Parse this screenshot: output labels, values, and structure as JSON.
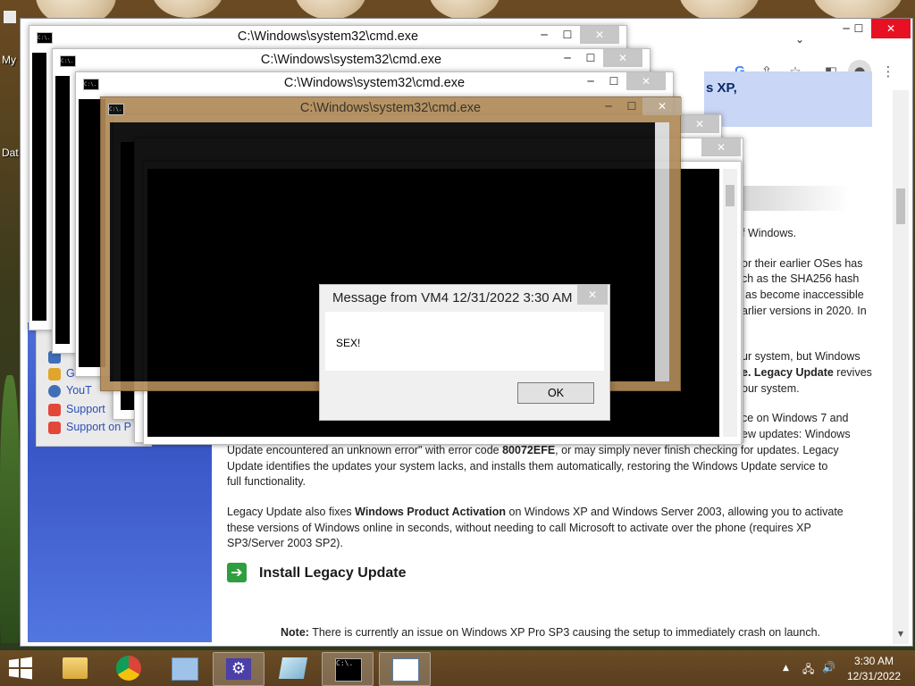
{
  "desktop": {
    "icon_label_1": "My",
    "icon_label_2": "Dat"
  },
  "browser": {
    "minimize": "─",
    "maximize": "☐",
    "close": "✕",
    "tab_dropdown": "⌄",
    "banner_text": "s XP,",
    "article": {
      "p1": "f Windows.",
      "p2a": "or their earlier OSes has",
      "p2b": "ch as the SHA256 hash",
      "p2c": "as become inaccessible",
      "p2d": "arlier versions in 2020. In",
      "p3a": "ur system, but Windows",
      "p3b_bold": "e. Legacy Update",
      "p3b_rest": " revives",
      "p3c": "our system.",
      "p4a": "ce on Windows 7 and",
      "p4b": "ew updates: Windows",
      "p4c_pre": "Update encountered an unknown error\" with error code ",
      "p4c_bold": "80072EFE",
      "p4c_post": ", or may simply never finish checking for updates. Legacy",
      "p4d": "Update identifies the updates your system lacks, and installs them automatically, restoring the Windows Update service to",
      "p4e": "full functionality.",
      "p5a_pre": "Legacy Update also fixes ",
      "p5a_bold": "Windows Product Activation",
      "p5a_post": " on Windows XP and Windows Server 2003, allowing you to activate",
      "p5b": "these versions of Windows online in seconds, without needing to call Microsoft to activate over the phone (requires XP",
      "p5c": "SP3/Server 2003 SP2).",
      "install_heading": "Install Legacy Update",
      "install_arrow": "➔",
      "note_bold": "Note:",
      "note_rest": " There is currently an issue on Windows XP Pro SP3 causing the setup to immediately crash on launch."
    }
  },
  "favorites": {
    "items": [
      {
        "label": "GitH"
      },
      {
        "label": "YouT"
      },
      {
        "label": "Support"
      },
      {
        "label": "Support on P"
      }
    ]
  },
  "cmd_windows": {
    "title": "C:\\Windows\\system32\\cmd.exe",
    "icon_text": "C:\\.",
    "minimize": "─",
    "maximize": "☐",
    "close": "✕"
  },
  "message_box": {
    "title": "Message from VM4 12/31/2022 3:30 AM",
    "text": "SEX!",
    "ok_label": "OK",
    "close": "✕"
  },
  "taskbar": {
    "time": "3:30 AM",
    "date": "12/31/2022",
    "tray_chevron": "▲",
    "tray_network": "🖧",
    "tray_volume": "🔊"
  },
  "colors": {
    "close_red": "#e81123",
    "taskbar": "#5a3f1f",
    "sidebar_blue": "#3a57c7",
    "cmd_tan": "#b08a58"
  }
}
